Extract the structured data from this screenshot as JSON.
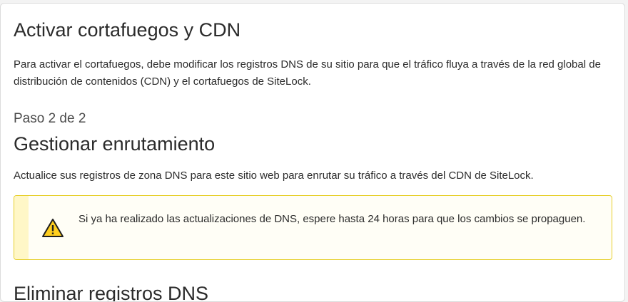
{
  "header": {
    "title": "Activar cortafuegos y CDN",
    "intro": "Para activar el cortafuegos, debe modificar los registros DNS de su sitio para que el tráfico fluya a través de la red global de distribución de contenidos (CDN) y el cortafuegos de SiteLock."
  },
  "step": {
    "indicator": "Paso 2 de 2",
    "title": "Gestionar enrutamiento",
    "description": "Actualice sus registros de zona DNS para este sitio web para enrutar su tráfico a través del CDN de SiteLock."
  },
  "alert": {
    "icon": "warning-icon",
    "message": "Si ya ha realizado las actualizaciones de DNS, espere hasta 24 horas para que los cambios se propaguen.",
    "border_color": "#e6cf2a",
    "bar_color": "#fff7c7"
  },
  "next_section": {
    "title": "Eliminar registros DNS"
  }
}
